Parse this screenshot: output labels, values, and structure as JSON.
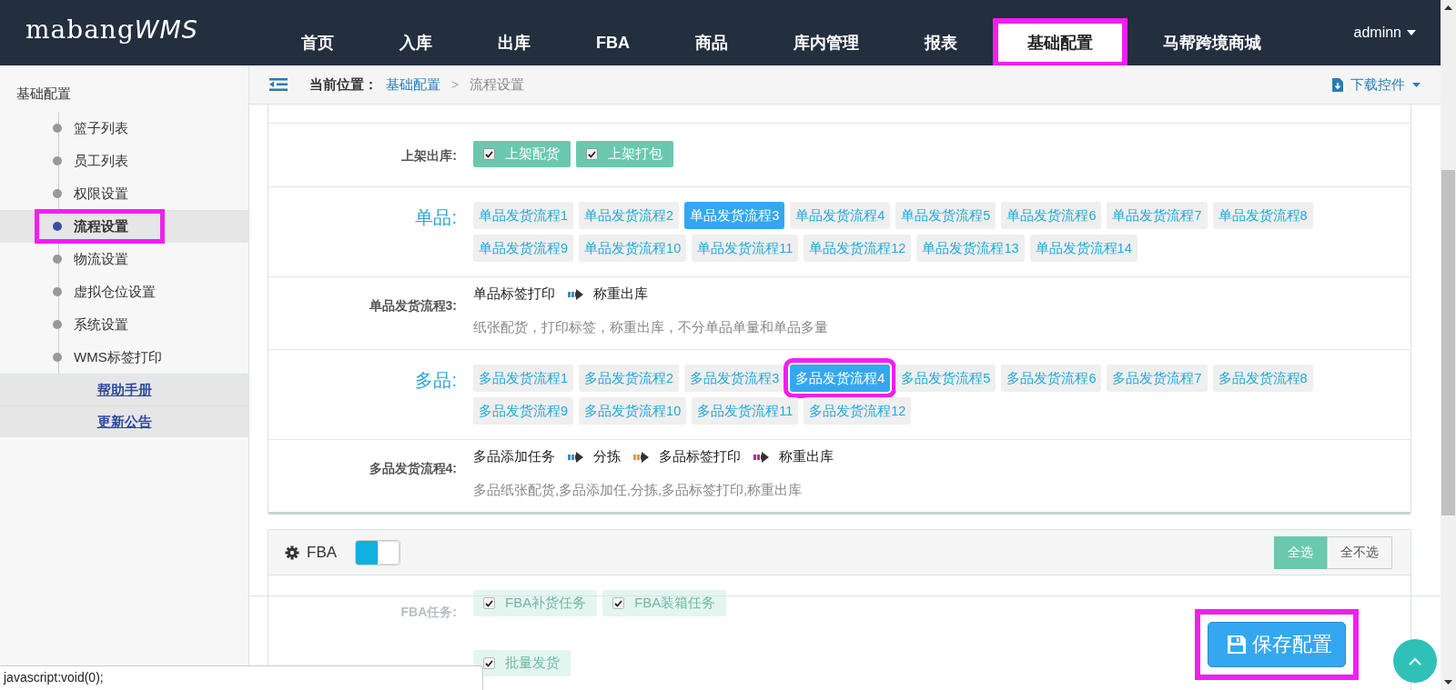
{
  "header": {
    "logo": {
      "text": "mabang",
      "accent": "WMS"
    },
    "nav": [
      {
        "label": "首页",
        "selected": false,
        "highlighted": false
      },
      {
        "label": "入库",
        "selected": false,
        "highlighted": false
      },
      {
        "label": "出库",
        "selected": false,
        "highlighted": false
      },
      {
        "label": "FBA",
        "selected": false,
        "highlighted": false
      },
      {
        "label": "商品",
        "selected": false,
        "highlighted": false
      },
      {
        "label": "库内管理",
        "selected": false,
        "highlighted": false
      },
      {
        "label": "报表",
        "selected": false,
        "highlighted": false
      },
      {
        "label": "基础配置",
        "selected": true,
        "highlighted": true
      },
      {
        "label": "马帮跨境商城",
        "selected": false,
        "highlighted": false
      }
    ],
    "user": "adminn"
  },
  "sidebar": {
    "title": "基础配置",
    "items": [
      {
        "label": "篮子列表",
        "selected": false,
        "highlighted": false
      },
      {
        "label": "员工列表",
        "selected": false,
        "highlighted": false
      },
      {
        "label": "权限设置",
        "selected": false,
        "highlighted": false
      },
      {
        "label": "流程设置",
        "selected": true,
        "highlighted": true
      },
      {
        "label": "物流设置",
        "selected": false,
        "highlighted": false
      },
      {
        "label": "虚拟仓位设置",
        "selected": false,
        "highlighted": false
      },
      {
        "label": "系统设置",
        "selected": false,
        "highlighted": false
      },
      {
        "label": "WMS标签打印",
        "selected": false,
        "highlighted": false
      }
    ],
    "links": [
      "帮助手册",
      "更新公告"
    ]
  },
  "breadcrumb": {
    "label": "当前位置：",
    "link": "基础配置",
    "separator": ">",
    "current": "流程设置",
    "download": "下载控件"
  },
  "flow_panel": {
    "rows": [
      {
        "kind": "checks",
        "label": "上架出库:",
        "options": [
          {
            "label": "上架配货",
            "checked": true
          },
          {
            "label": "上架打包",
            "checked": true
          }
        ]
      },
      {
        "kind": "flows",
        "label": "单品:",
        "options": [
          {
            "label": "单品发货流程1",
            "selected": false,
            "highlighted": false
          },
          {
            "label": "单品发货流程2",
            "selected": false,
            "highlighted": false
          },
          {
            "label": "单品发货流程3",
            "selected": true,
            "highlighted": false
          },
          {
            "label": "单品发货流程4",
            "selected": false,
            "highlighted": false
          },
          {
            "label": "单品发货流程5",
            "selected": false,
            "highlighted": false
          },
          {
            "label": "单品发货流程6",
            "selected": false,
            "highlighted": false
          },
          {
            "label": "单品发货流程7",
            "selected": false,
            "highlighted": false
          },
          {
            "label": "单品发货流程8",
            "selected": false,
            "highlighted": false
          },
          {
            "label": "单品发货流程9",
            "selected": false,
            "highlighted": false
          },
          {
            "label": "单品发货流程10",
            "selected": false,
            "highlighted": false
          },
          {
            "label": "单品发货流程11",
            "selected": false,
            "highlighted": false
          },
          {
            "label": "单品发货流程12",
            "selected": false,
            "highlighted": false
          },
          {
            "label": "单品发货流程13",
            "selected": false,
            "highlighted": false
          },
          {
            "label": "单品发货流程14",
            "selected": false,
            "highlighted": false
          }
        ]
      },
      {
        "kind": "steps",
        "label": "单品发货流程3:",
        "steps": [
          {
            "label": "单品标签打印",
            "color": "#3c8dbc"
          },
          {
            "label": "称重出库"
          }
        ],
        "description": "纸张配货，打印标签，称重出库，不分单品单量和单品多量"
      },
      {
        "kind": "flows",
        "label": "多品:",
        "options": [
          {
            "label": "多品发货流程1",
            "selected": false,
            "highlighted": false
          },
          {
            "label": "多品发货流程2",
            "selected": false,
            "highlighted": false
          },
          {
            "label": "多品发货流程3",
            "selected": false,
            "highlighted": false
          },
          {
            "label": "多品发货流程4",
            "selected": true,
            "highlighted": true
          },
          {
            "label": "多品发货流程5",
            "selected": false,
            "highlighted": false
          },
          {
            "label": "多品发货流程6",
            "selected": false,
            "highlighted": false
          },
          {
            "label": "多品发货流程7",
            "selected": false,
            "highlighted": false
          },
          {
            "label": "多品发货流程8",
            "selected": false,
            "highlighted": false
          },
          {
            "label": "多品发货流程9",
            "selected": false,
            "highlighted": false
          },
          {
            "label": "多品发货流程10",
            "selected": false,
            "highlighted": false
          },
          {
            "label": "多品发货流程11",
            "selected": false,
            "highlighted": false
          },
          {
            "label": "多品发货流程12",
            "selected": false,
            "highlighted": false
          }
        ]
      },
      {
        "kind": "steps",
        "label": "多品发货流程4:",
        "steps": [
          {
            "label": "多品添加任务",
            "color": "#3c8dbc"
          },
          {
            "label": "分拣",
            "color": "#e0a030"
          },
          {
            "label": "多品标签打印",
            "color": "#b03090"
          },
          {
            "label": "称重出库"
          }
        ],
        "description": "多品纸张配货,多品添加任,分拣,多品标签打印,称重出库"
      }
    ]
  },
  "fba_panel": {
    "title": "FBA",
    "on": true,
    "buttons": [
      {
        "label": "全选",
        "selected": true
      },
      {
        "label": "全不选",
        "selected": false
      }
    ],
    "rows": [
      {
        "label": "FBA任务:",
        "options": [
          {
            "label": "FBA补货任务",
            "checked": true
          },
          {
            "label": "FBA装箱任务",
            "checked": true
          }
        ]
      },
      {
        "options": [
          {
            "label": "批量发货",
            "checked": true
          }
        ]
      }
    ]
  },
  "save_button": {
    "label": "保存配置",
    "highlighted": true
  },
  "status_bar": "javascript:void(0);"
}
